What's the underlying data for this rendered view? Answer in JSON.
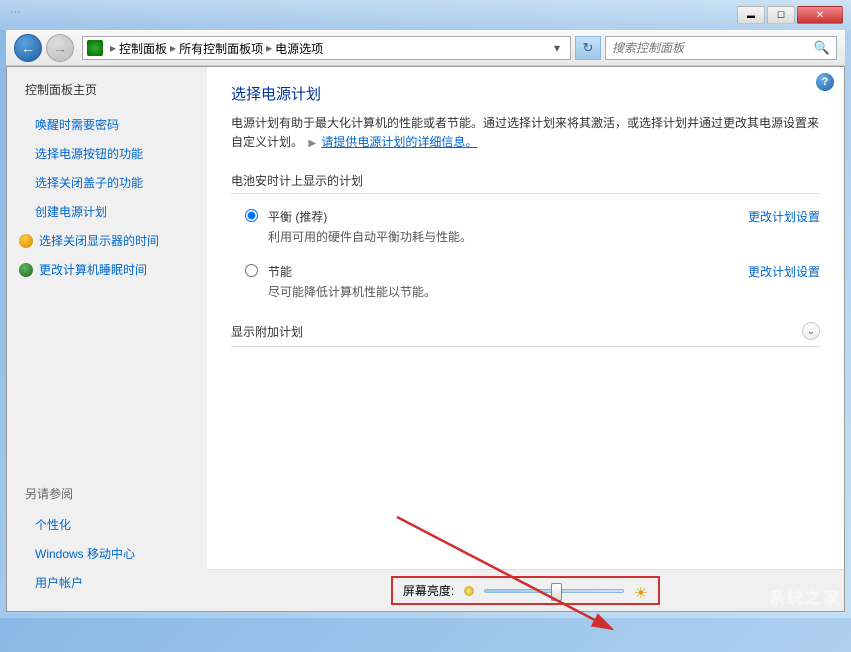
{
  "window": {
    "title_hint": "···"
  },
  "breadcrumb": {
    "items": [
      "控制面板",
      "所有控制面板项",
      "电源选项"
    ]
  },
  "search": {
    "placeholder": "搜索控制面板"
  },
  "sidebar": {
    "home": "控制面板主页",
    "links": [
      "唤醒时需要密码",
      "选择电源按钮的功能",
      "选择关闭盖子的功能",
      "创建电源计划"
    ],
    "icon_links": [
      "选择关闭显示器的时间",
      "更改计算机睡眠时间"
    ],
    "see_also_title": "另请参阅",
    "see_also": [
      "个性化",
      "Windows 移动中心",
      "用户帐户"
    ]
  },
  "main": {
    "title": "选择电源计划",
    "desc_before": "电源计划有助于最大化计算机的性能或者节能。通过选择计划来将其激活，或选择计划并通过更改其电源设置来自定义计划。",
    "desc_link": "请提供电源计划的详细信息。",
    "section_shown": "电池安时计上显示的计划",
    "plan_balanced": {
      "name": "平衡 (推荐)",
      "desc": "利用可用的硬件自动平衡功耗与性能。",
      "edit": "更改计划设置"
    },
    "plan_saver": {
      "name": "节能",
      "desc": "尽可能降低计算机性能以节能。",
      "edit": "更改计划设置"
    },
    "section_more": "显示附加计划",
    "brightness_label": "屏幕亮度:"
  },
  "watermark": "系统之家"
}
